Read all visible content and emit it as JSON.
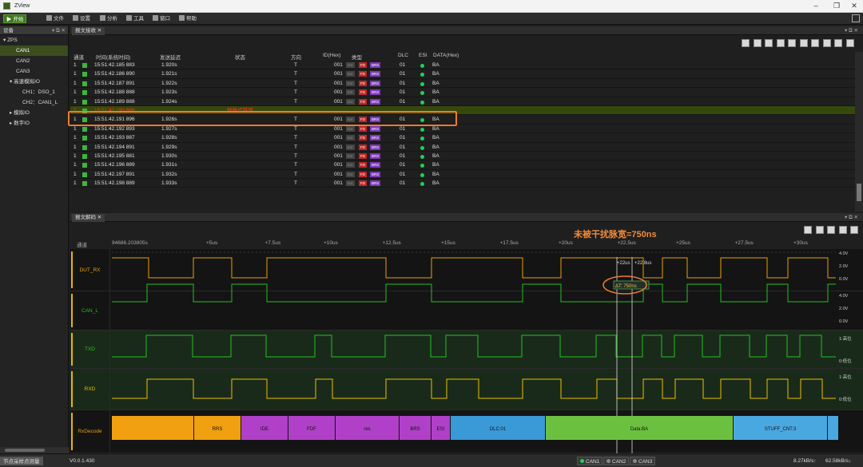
{
  "window": {
    "title": "ZView"
  },
  "menu": {
    "start": "开始",
    "items": [
      "文件",
      "设置",
      "分析",
      "工具",
      "窗口",
      "帮助"
    ]
  },
  "sidebar": {
    "title": "设备",
    "tree": [
      {
        "label": "ZPS",
        "arrow": "▾",
        "indent": 0,
        "selected": false
      },
      {
        "label": "CAN1",
        "arrow": "",
        "indent": 2,
        "selected": true
      },
      {
        "label": "CAN2",
        "arrow": "",
        "indent": 2,
        "selected": false
      },
      {
        "label": "CAN3",
        "arrow": "",
        "indent": 2,
        "selected": false
      },
      {
        "label": "高速模拟IO",
        "arrow": "▾",
        "indent": 1,
        "selected": false
      },
      {
        "label": "CH1：DSO_1",
        "arrow": "",
        "indent": 3,
        "selected": false
      },
      {
        "label": "CH2：CAN1_L",
        "arrow": "",
        "indent": 3,
        "selected": false
      },
      {
        "label": "模拟IO",
        "arrow": "▸",
        "indent": 1,
        "selected": false
      },
      {
        "label": "数字IO",
        "arrow": "▸",
        "indent": 1,
        "selected": false
      }
    ]
  },
  "rx_panel": {
    "tab": "报文接收",
    "columns": [
      "通道",
      "时间(系统时间)",
      "发送延迟",
      "状态",
      "方向",
      "ID(Hex)",
      "类型",
      "DLC",
      "ESI",
      "DATA(Hex)"
    ],
    "rows": [
      {
        "ch": "1",
        "time": "15:51:42.185 883",
        "delay": "1.920s",
        "status": "",
        "dir": "T",
        "id": "001",
        "dlc": "01",
        "data": "BA",
        "error": false
      },
      {
        "ch": "1",
        "time": "15:51:42.186 890",
        "delay": "1.921s",
        "status": "",
        "dir": "T",
        "id": "001",
        "dlc": "01",
        "data": "BA",
        "error": false
      },
      {
        "ch": "1",
        "time": "15:51:42.187 891",
        "delay": "1.922s",
        "status": "",
        "dir": "T",
        "id": "001",
        "dlc": "01",
        "data": "BA",
        "error": false
      },
      {
        "ch": "1",
        "time": "15:51:42.188 888",
        "delay": "1.923s",
        "status": "",
        "dir": "T",
        "id": "001",
        "dlc": "01",
        "data": "BA",
        "error": false
      },
      {
        "ch": "1",
        "time": "15:51:42.189 888",
        "delay": "1.924s",
        "status": "",
        "dir": "T",
        "id": "001",
        "dlc": "01",
        "data": "BA",
        "error": false
      },
      {
        "ch": "1",
        "time": "15:51:42.190 888",
        "delay": "",
        "status": "帧格式错误",
        "dir": "",
        "id": "",
        "dlc": "",
        "data": "",
        "error": true
      },
      {
        "ch": "1",
        "time": "15:51:42.191 896",
        "delay": "1.926s",
        "status": "",
        "dir": "T",
        "id": "001",
        "dlc": "01",
        "data": "BA",
        "error": false
      },
      {
        "ch": "1",
        "time": "15:51:42.192 893",
        "delay": "1.927s",
        "status": "",
        "dir": "T",
        "id": "001",
        "dlc": "01",
        "data": "BA",
        "error": false
      },
      {
        "ch": "1",
        "time": "15:51:42.193 887",
        "delay": "1.928s",
        "status": "",
        "dir": "T",
        "id": "001",
        "dlc": "01",
        "data": "BA",
        "error": false
      },
      {
        "ch": "1",
        "time": "15:51:42.194 891",
        "delay": "1.929s",
        "status": "",
        "dir": "T",
        "id": "001",
        "dlc": "01",
        "data": "BA",
        "error": false
      },
      {
        "ch": "1",
        "time": "15:51:42.195 881",
        "delay": "1.930s",
        "status": "",
        "dir": "T",
        "id": "001",
        "dlc": "01",
        "data": "BA",
        "error": false
      },
      {
        "ch": "1",
        "time": "15:51:42.196 889",
        "delay": "1.931s",
        "status": "",
        "dir": "T",
        "id": "001",
        "dlc": "01",
        "data": "BA",
        "error": false
      },
      {
        "ch": "1",
        "time": "15:51:42.197 891",
        "delay": "1.932s",
        "status": "",
        "dir": "T",
        "id": "001",
        "dlc": "01",
        "data": "BA",
        "error": false
      },
      {
        "ch": "1",
        "time": "15:51:42.198 889",
        "delay": "1.933s",
        "status": "",
        "dir": "T",
        "id": "001",
        "dlc": "01",
        "data": "BA",
        "error": false
      }
    ],
    "badges": [
      "Ext",
      "FD",
      "BRS"
    ]
  },
  "decode_panel": {
    "tab": "报文解码",
    "annotation": "未被干扰脉宽=750ns",
    "ruler_label": "通道",
    "start_time": "94686.203805s",
    "ticks": [
      "+5us",
      "+7.5us",
      "+10us",
      "+12.5us",
      "+15us",
      "+17.5us",
      "+20us",
      "+22.5us",
      "+25us",
      "+27.5us",
      "+30us"
    ],
    "cursor_labels": [
      "+22us",
      "+22.8us"
    ],
    "measure_label": "ΔT: 750ns",
    "lanes": [
      {
        "name": "DUT_RX",
        "color": "#e8a000",
        "scale": [
          "4.0V",
          "2.0V",
          "0.0V"
        ]
      },
      {
        "name": "CAN_L",
        "color": "#22c022",
        "scale": [
          "4.0V",
          "2.0V",
          "0.0V"
        ]
      },
      {
        "name": "TXD",
        "color": "#22c022",
        "scale": [
          "1:高位",
          "0:低位"
        ]
      },
      {
        "name": "RXD",
        "color": "#e8c000",
        "scale": [
          "1:高位",
          "0:低位"
        ]
      },
      {
        "name": "RxDecode",
        "color": "#e8a000",
        "scale": []
      }
    ],
    "segments": [
      {
        "label": "",
        "color": "#f0a010"
      },
      {
        "label": "RRS",
        "color": "#f0a010"
      },
      {
        "label": "IDE",
        "color": "#b040c8"
      },
      {
        "label": "FDF",
        "color": "#b040c8"
      },
      {
        "label": "res",
        "color": "#b040c8"
      },
      {
        "label": "BRS",
        "color": "#b040c8"
      },
      {
        "label": "ESI",
        "color": "#b040c8"
      },
      {
        "label": "DLC:01",
        "color": "#3a9ad8"
      },
      {
        "label": "Data:BA",
        "color": "#6cc040"
      },
      {
        "label": "STUFF_CNT:3",
        "color": "#4aa8e0"
      },
      {
        "label": "",
        "color": "#4aa8e0"
      }
    ]
  },
  "status": {
    "hint": "节点采样点测量",
    "version": "V0.0.1.430",
    "channels": [
      "CAN1",
      "CAN2",
      "CAN3"
    ],
    "rate1": "8.27kB/s↑",
    "rate2": "62.58kB/s↓"
  }
}
